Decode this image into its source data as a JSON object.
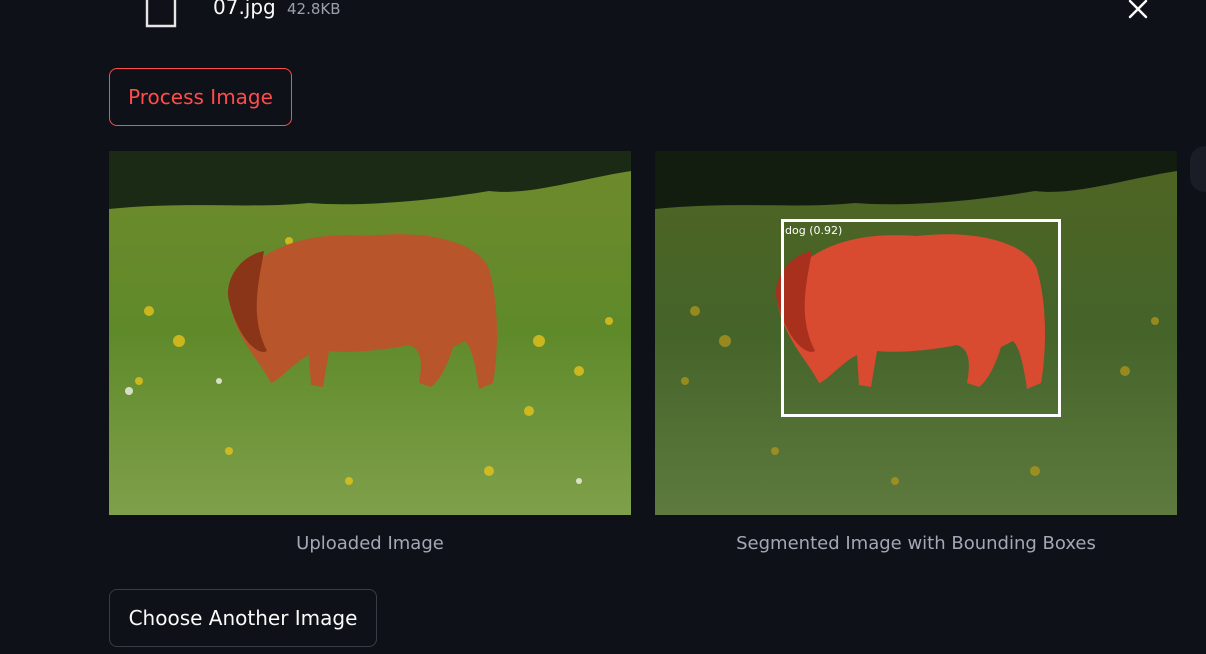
{
  "file": {
    "name": "07.jpg",
    "size": "42.8KB",
    "icon": "file-icon",
    "close_icon": "close-icon"
  },
  "actions": {
    "process_label": "Process Image",
    "choose_label": "Choose Another Image"
  },
  "images": {
    "uploaded": {
      "caption": "Uploaded Image"
    },
    "segmented": {
      "caption": "Segmented Image with Bounding Boxes",
      "detection_label": "dog (0.92)"
    }
  },
  "colors": {
    "background": "#0e1117",
    "accent": "#ff4b4b",
    "caption": "#a3a8b4"
  }
}
